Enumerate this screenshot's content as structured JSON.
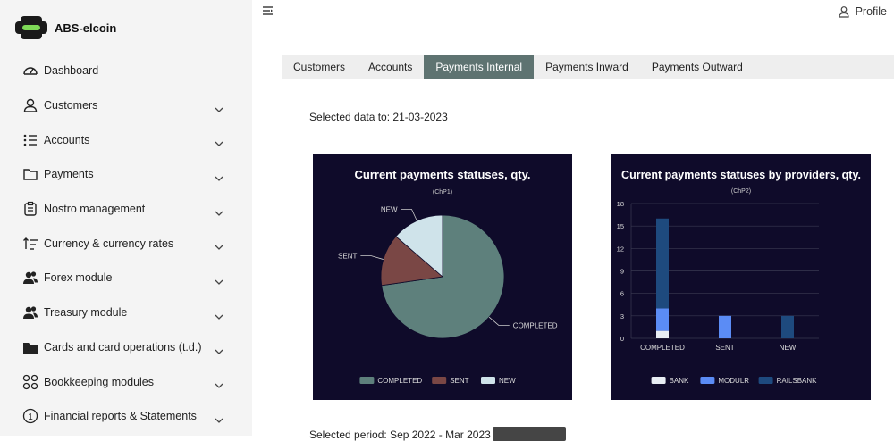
{
  "app": {
    "title": "ABS-elcoin"
  },
  "header": {
    "profile_label": "Profile",
    "menu_icon": "collapse-menu-icon",
    "profile_icon": "user-icon"
  },
  "sidebar": {
    "items": [
      {
        "label": "Dashboard",
        "icon": "dashboard-icon",
        "expandable": false
      },
      {
        "label": "Customers",
        "icon": "user-icon",
        "expandable": true
      },
      {
        "label": "Accounts",
        "icon": "list-icon",
        "expandable": true
      },
      {
        "label": "Payments",
        "icon": "folder-icon",
        "expandable": true
      },
      {
        "label": "Nostro management",
        "icon": "clipboard-icon",
        "expandable": true
      },
      {
        "label": "Currency & currency rates",
        "icon": "sort-icon",
        "expandable": true
      },
      {
        "label": "Forex module",
        "icon": "users-icon",
        "expandable": true
      },
      {
        "label": "Treasury module",
        "icon": "users-icon",
        "expandable": true
      },
      {
        "label": "Cards and card operations (t.d.)",
        "icon": "card-folder-icon",
        "expandable": true
      },
      {
        "label": "Bookkeeping modules",
        "icon": "grid-icon",
        "expandable": true
      },
      {
        "label": "Financial reports & Statements",
        "icon": "info-circle-icon",
        "expandable": true
      }
    ]
  },
  "tabs": [
    {
      "label": "Customers",
      "active": false
    },
    {
      "label": "Accounts",
      "active": false
    },
    {
      "label": "Payments Internal",
      "active": true
    },
    {
      "label": "Payments Inward",
      "active": false
    },
    {
      "label": "Payments Outward",
      "active": false
    }
  ],
  "main": {
    "selected_date": "Selected data to: 21-03-2023",
    "bottom_text": "Selected period: Sep 2022 - Mar 2023"
  },
  "colors": {
    "tab_active": "#5e7371",
    "chart_bg": "#0f0b2a",
    "sidebar_bg": "#f4f4f4"
  },
  "chart_data": [
    {
      "type": "pie",
      "title": "Current payments statuses, qty.",
      "subtitle": "(ChP1)",
      "categories": [
        "COMPLETED",
        "SENT",
        "NEW"
      ],
      "values": [
        16,
        3,
        3
      ],
      "colors": [
        "#5e807c",
        "#7a4745",
        "#cfe3ea"
      ],
      "legend": "bottom"
    },
    {
      "type": "bar",
      "stacked": true,
      "title": "Current payments statuses by providers, qty.",
      "subtitle": "(ChP2)",
      "categories": [
        "COMPLETED",
        "SENT",
        "NEW"
      ],
      "series": [
        {
          "name": "BANK",
          "values": [
            1,
            0,
            0
          ],
          "color": "#e8eef4"
        },
        {
          "name": "MODULR",
          "values": [
            3,
            3,
            0
          ],
          "color": "#5b8cf5"
        },
        {
          "name": "RAILSBANK",
          "values": [
            12,
            0,
            3
          ],
          "color": "#1e4a7e"
        }
      ],
      "yticks": [
        "0",
        "3",
        "6",
        "9",
        "12",
        "15",
        "18"
      ],
      "ylim": [
        0,
        18
      ],
      "grid": true,
      "legend": "bottom"
    }
  ]
}
